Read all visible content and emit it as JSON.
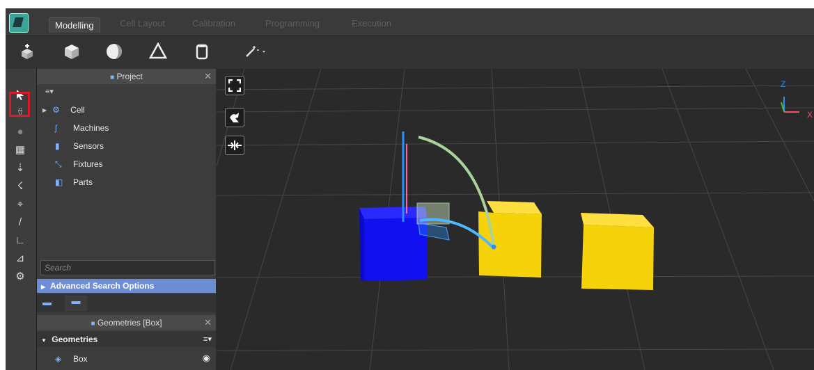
{
  "tabs": [
    "Modelling",
    "Cell Layout",
    "Calibration",
    "Programming",
    "Execution"
  ],
  "active_tab": "Modelling",
  "project_panel": {
    "title": "Project",
    "menu_glyph": "≡▾",
    "tree": [
      {
        "label": "Cell",
        "icon": "cell-icon",
        "expandable": true
      },
      {
        "label": "Machines",
        "icon": "machine-icon"
      },
      {
        "label": "Sensors",
        "icon": "sensor-icon"
      },
      {
        "label": "Fixtures",
        "icon": "fixture-icon"
      },
      {
        "label": "Parts",
        "icon": "part-icon"
      }
    ],
    "search_placeholder": "Search",
    "advanced_search_label": "Advanced Search Options"
  },
  "geometries_panel": {
    "title": "Geometries [Box]",
    "section_label": "Geometries",
    "menu_glyph": "≡▾",
    "item_label": "Box"
  },
  "viewport": {
    "axis_labels": {
      "z": "Z",
      "x": "X"
    },
    "colors": {
      "blue_box": "#1010f0",
      "yellow_box": "#f5d20a",
      "grid_line": "#444444"
    }
  },
  "colors": {
    "accent_selection": "#e0192a",
    "advanced_search_bg": "#6d8ed6"
  }
}
